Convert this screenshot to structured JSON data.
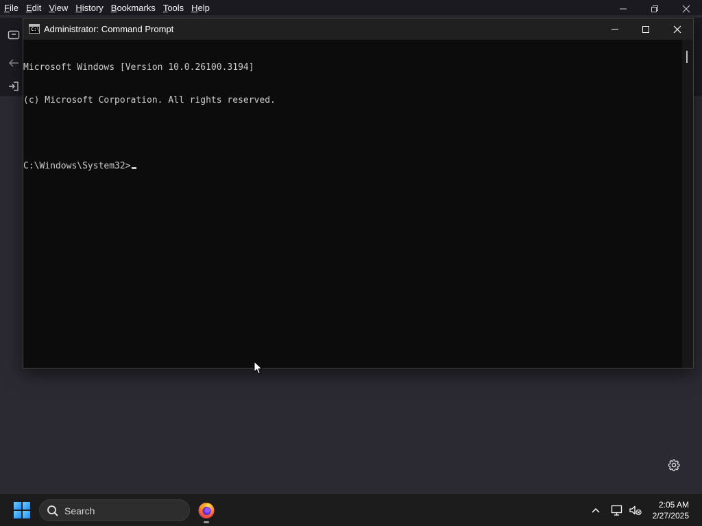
{
  "firefox": {
    "menubar": [
      {
        "label": "File",
        "accel": "F",
        "rest": "ile"
      },
      {
        "label": "Edit",
        "accel": "E",
        "rest": "dit"
      },
      {
        "label": "View",
        "accel": "V",
        "rest": "iew"
      },
      {
        "label": "History",
        "accel": "H",
        "rest": "istory"
      },
      {
        "label": "Bookmarks",
        "accel": "B",
        "rest": "ookmarks"
      },
      {
        "label": "Tools",
        "accel": "T",
        "rest": "ools"
      },
      {
        "label": "Help",
        "accel": "H",
        "rest": "elp"
      }
    ]
  },
  "cmd": {
    "title": "Administrator: Command Prompt",
    "lines": [
      "Microsoft Windows [Version 10.0.26100.3194]",
      "(c) Microsoft Corporation. All rights reserved.",
      "",
      "C:\\Windows\\System32>"
    ]
  },
  "taskbar": {
    "search_label": "Search",
    "time": "2:05 AM",
    "date": "2/27/2025"
  },
  "icons": {
    "start": "windows-logo-icon",
    "search": "search-icon",
    "firefox": "firefox-icon",
    "tray_chevron": "chevron-up-icon",
    "network": "network-icon",
    "volume": "volume-muted-icon",
    "settings": "gear-icon"
  },
  "colors": {
    "cmd_background": "#0c0c0c",
    "cmd_text": "#cccccc",
    "cmd_titlebar": "#202020",
    "firefox_chrome": "#1c1b22",
    "firefox_content": "#2b2a33",
    "taskbar": "#1c1c1c",
    "windows_accent": "#1a8cff"
  }
}
